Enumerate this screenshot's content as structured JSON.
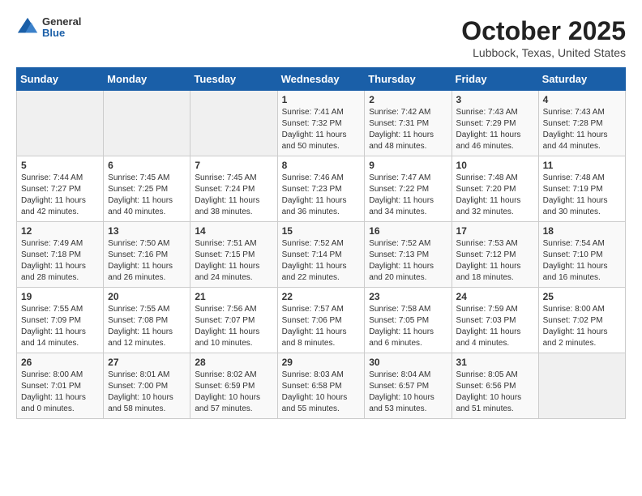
{
  "header": {
    "logo_general": "General",
    "logo_blue": "Blue",
    "month": "October 2025",
    "location": "Lubbock, Texas, United States"
  },
  "weekdays": [
    "Sunday",
    "Monday",
    "Tuesday",
    "Wednesday",
    "Thursday",
    "Friday",
    "Saturday"
  ],
  "weeks": [
    [
      {
        "day": "",
        "info": ""
      },
      {
        "day": "",
        "info": ""
      },
      {
        "day": "",
        "info": ""
      },
      {
        "day": "1",
        "info": "Sunrise: 7:41 AM\nSunset: 7:32 PM\nDaylight: 11 hours\nand 50 minutes."
      },
      {
        "day": "2",
        "info": "Sunrise: 7:42 AM\nSunset: 7:31 PM\nDaylight: 11 hours\nand 48 minutes."
      },
      {
        "day": "3",
        "info": "Sunrise: 7:43 AM\nSunset: 7:29 PM\nDaylight: 11 hours\nand 46 minutes."
      },
      {
        "day": "4",
        "info": "Sunrise: 7:43 AM\nSunset: 7:28 PM\nDaylight: 11 hours\nand 44 minutes."
      }
    ],
    [
      {
        "day": "5",
        "info": "Sunrise: 7:44 AM\nSunset: 7:27 PM\nDaylight: 11 hours\nand 42 minutes."
      },
      {
        "day": "6",
        "info": "Sunrise: 7:45 AM\nSunset: 7:25 PM\nDaylight: 11 hours\nand 40 minutes."
      },
      {
        "day": "7",
        "info": "Sunrise: 7:45 AM\nSunset: 7:24 PM\nDaylight: 11 hours\nand 38 minutes."
      },
      {
        "day": "8",
        "info": "Sunrise: 7:46 AM\nSunset: 7:23 PM\nDaylight: 11 hours\nand 36 minutes."
      },
      {
        "day": "9",
        "info": "Sunrise: 7:47 AM\nSunset: 7:22 PM\nDaylight: 11 hours\nand 34 minutes."
      },
      {
        "day": "10",
        "info": "Sunrise: 7:48 AM\nSunset: 7:20 PM\nDaylight: 11 hours\nand 32 minutes."
      },
      {
        "day": "11",
        "info": "Sunrise: 7:48 AM\nSunset: 7:19 PM\nDaylight: 11 hours\nand 30 minutes."
      }
    ],
    [
      {
        "day": "12",
        "info": "Sunrise: 7:49 AM\nSunset: 7:18 PM\nDaylight: 11 hours\nand 28 minutes."
      },
      {
        "day": "13",
        "info": "Sunrise: 7:50 AM\nSunset: 7:16 PM\nDaylight: 11 hours\nand 26 minutes."
      },
      {
        "day": "14",
        "info": "Sunrise: 7:51 AM\nSunset: 7:15 PM\nDaylight: 11 hours\nand 24 minutes."
      },
      {
        "day": "15",
        "info": "Sunrise: 7:52 AM\nSunset: 7:14 PM\nDaylight: 11 hours\nand 22 minutes."
      },
      {
        "day": "16",
        "info": "Sunrise: 7:52 AM\nSunset: 7:13 PM\nDaylight: 11 hours\nand 20 minutes."
      },
      {
        "day": "17",
        "info": "Sunrise: 7:53 AM\nSunset: 7:12 PM\nDaylight: 11 hours\nand 18 minutes."
      },
      {
        "day": "18",
        "info": "Sunrise: 7:54 AM\nSunset: 7:10 PM\nDaylight: 11 hours\nand 16 minutes."
      }
    ],
    [
      {
        "day": "19",
        "info": "Sunrise: 7:55 AM\nSunset: 7:09 PM\nDaylight: 11 hours\nand 14 minutes."
      },
      {
        "day": "20",
        "info": "Sunrise: 7:55 AM\nSunset: 7:08 PM\nDaylight: 11 hours\nand 12 minutes."
      },
      {
        "day": "21",
        "info": "Sunrise: 7:56 AM\nSunset: 7:07 PM\nDaylight: 11 hours\nand 10 minutes."
      },
      {
        "day": "22",
        "info": "Sunrise: 7:57 AM\nSunset: 7:06 PM\nDaylight: 11 hours\nand 8 minutes."
      },
      {
        "day": "23",
        "info": "Sunrise: 7:58 AM\nSunset: 7:05 PM\nDaylight: 11 hours\nand 6 minutes."
      },
      {
        "day": "24",
        "info": "Sunrise: 7:59 AM\nSunset: 7:03 PM\nDaylight: 11 hours\nand 4 minutes."
      },
      {
        "day": "25",
        "info": "Sunrise: 8:00 AM\nSunset: 7:02 PM\nDaylight: 11 hours\nand 2 minutes."
      }
    ],
    [
      {
        "day": "26",
        "info": "Sunrise: 8:00 AM\nSunset: 7:01 PM\nDaylight: 11 hours\nand 0 minutes."
      },
      {
        "day": "27",
        "info": "Sunrise: 8:01 AM\nSunset: 7:00 PM\nDaylight: 10 hours\nand 58 minutes."
      },
      {
        "day": "28",
        "info": "Sunrise: 8:02 AM\nSunset: 6:59 PM\nDaylight: 10 hours\nand 57 minutes."
      },
      {
        "day": "29",
        "info": "Sunrise: 8:03 AM\nSunset: 6:58 PM\nDaylight: 10 hours\nand 55 minutes."
      },
      {
        "day": "30",
        "info": "Sunrise: 8:04 AM\nSunset: 6:57 PM\nDaylight: 10 hours\nand 53 minutes."
      },
      {
        "day": "31",
        "info": "Sunrise: 8:05 AM\nSunset: 6:56 PM\nDaylight: 10 hours\nand 51 minutes."
      },
      {
        "day": "",
        "info": ""
      }
    ]
  ]
}
